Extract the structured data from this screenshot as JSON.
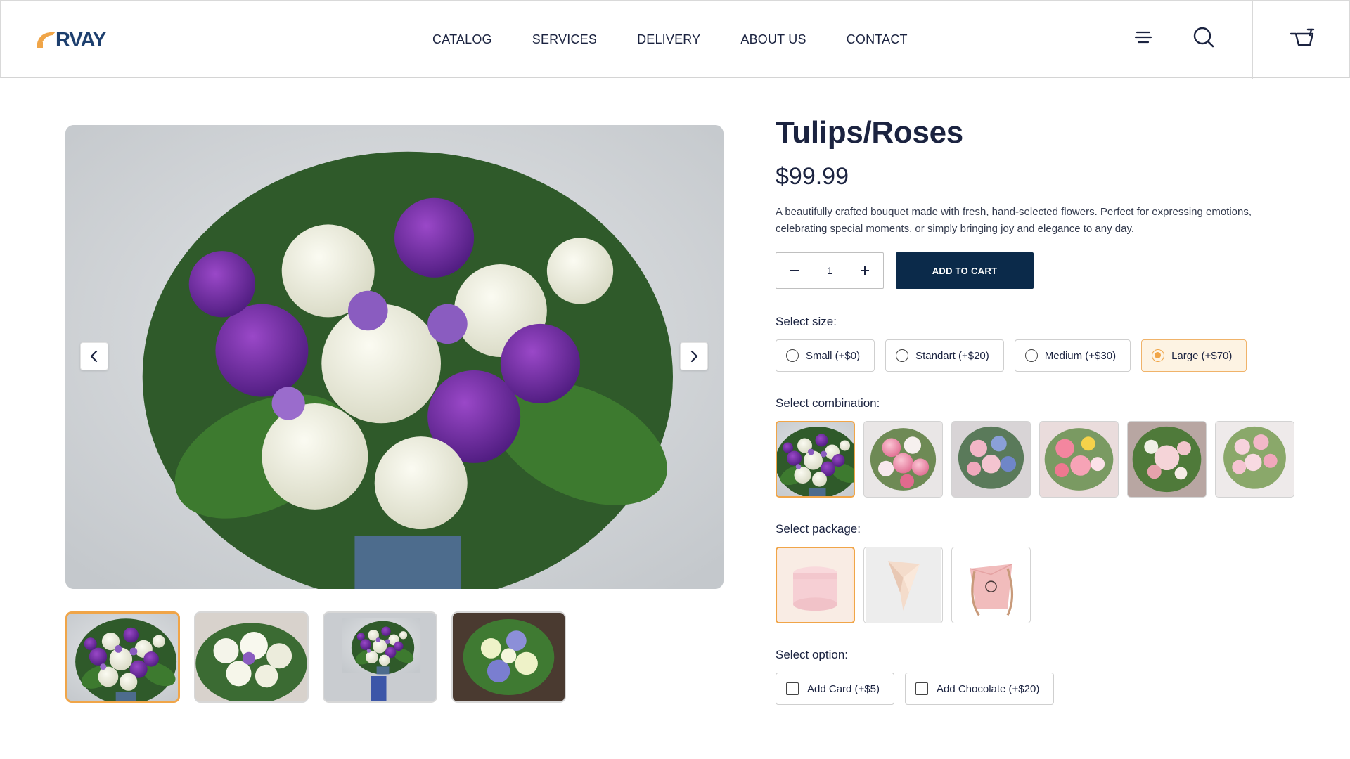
{
  "brand": {
    "name": "RVAY",
    "accent": "#f0a548",
    "navy": "#0b2a4a"
  },
  "nav": {
    "items": [
      "CATALOG",
      "SERVICES",
      "DELIVERY",
      "ABOUT US",
      "CONTACT"
    ]
  },
  "header_icons": [
    "menu-icon",
    "search-icon",
    "cart-icon"
  ],
  "product": {
    "title": "Tulips/Roses",
    "price": "$99.99",
    "description": "A beautifully crafted bouquet made with fresh, hand-selected flowers. Perfect for expressing emotions, celebrating special moments, or simply bringing joy and elegance to any day.",
    "quantity": "1",
    "add_to_cart": "ADD TO CART"
  },
  "gallery": {
    "selected_index": 0,
    "thumbnail_count": 4
  },
  "size": {
    "label": "Select size:",
    "options": [
      "Small (+$0)",
      "Standart (+$20)",
      "Medium (+$30)",
      "Large (+$70)"
    ],
    "selected": "Large (+$70)"
  },
  "combination": {
    "label": "Select combination:",
    "count": 6,
    "selected_index": 0
  },
  "package": {
    "label": "Select package:",
    "count": 3,
    "selected_index": 0
  },
  "option": {
    "label": "Select option:",
    "items": [
      "Add Card (+$5)",
      "Add Chocolate (+$20)"
    ]
  }
}
